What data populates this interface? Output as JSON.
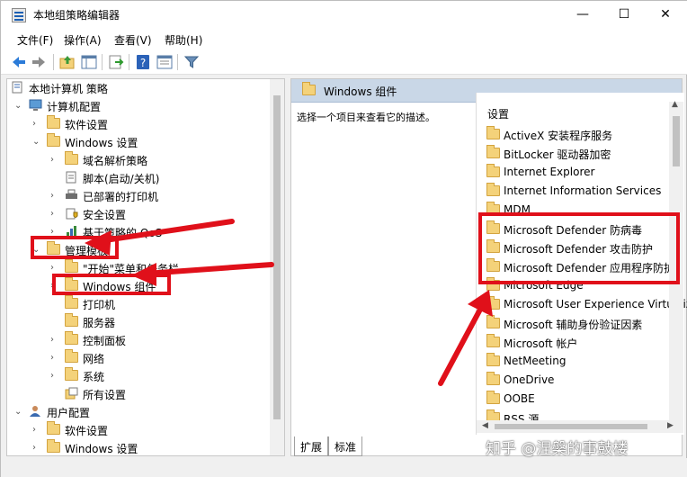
{
  "window": {
    "title": "本地组策略编辑器",
    "minimize_glyph": "—",
    "maximize_glyph": "☐",
    "close_glyph": "✕"
  },
  "menu": {
    "file": "文件(F)",
    "action": "操作(A)",
    "view": "查看(V)",
    "help": "帮助(H)"
  },
  "toolbar": {
    "buttons": [
      "back-icon",
      "forward-icon",
      "up-folder-icon",
      "show-hide-tree-icon",
      "export-list-icon",
      "help-icon",
      "properties-icon",
      "filter-icon"
    ]
  },
  "tree": {
    "root": "本地计算机 策略",
    "computer_config": "计算机配置",
    "software_settings": "软件设置",
    "windows_settings": "Windows 设置",
    "name_resolution": "域名解析策略",
    "scripts": "脚本(启动/关机)",
    "deployed_printers": "已部署的打印机",
    "security_settings": "安全设置",
    "qos": "基于策略的 QoS",
    "admin_templates": "管理模板",
    "start_menu": "\"开始\"菜单和任务栏",
    "windows_components": "Windows 组件",
    "printers": "打印机",
    "server": "服务器",
    "control_panel": "控制面板",
    "network": "网络",
    "system": "系统",
    "all_settings": "所有设置",
    "user_config": "用户配置",
    "user_software_settings": "软件设置",
    "user_windows_settings": "Windows 设置"
  },
  "right": {
    "header_title": "Windows 组件",
    "description": "选择一个项目来查看它的描述。",
    "settings_header": "设置",
    "items": [
      "ActiveX 安装程序服务",
      "BitLocker 驱动器加密",
      "Internet Explorer",
      "Internet Information Services",
      "MDM",
      "Microsoft Defender 防病毒",
      "Microsoft Defender 攻击防护",
      "Microsoft Defender 应用程序防护",
      "Microsoft Edge",
      "Microsoft User Experience Virtualization",
      "Microsoft 辅助身份验证因素",
      "Microsoft 帐户",
      "NetMeeting",
      "OneDrive",
      "OOBE",
      "RSS 源"
    ]
  },
  "tabs": {
    "extended": "扩展",
    "standard": "标准"
  },
  "watermark": "知乎 @涅槃的事鼓楼",
  "colors": {
    "annotation_red": "#e0101a",
    "header_blue": "#c9d7e7",
    "folder_yellow": "#f4d27a"
  }
}
